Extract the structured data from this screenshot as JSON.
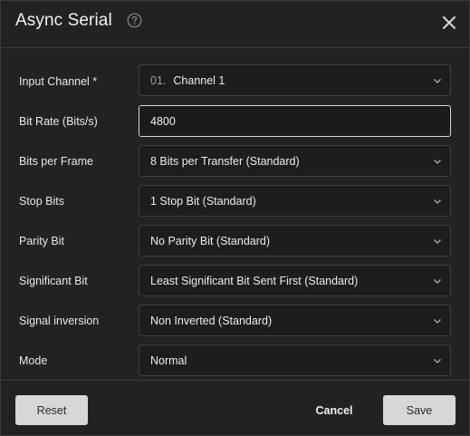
{
  "dialog": {
    "title": "Async Serial",
    "help_icon": "help-circle-icon",
    "close_icon": "close-icon"
  },
  "form": {
    "input_channel": {
      "label": "Input Channel *",
      "prefix": "01.",
      "value": "Channel 1"
    },
    "bit_rate": {
      "label": "Bit Rate (Bits/s)",
      "value": "4800"
    },
    "bits_per_frame": {
      "label": "Bits per Frame",
      "value": "8 Bits per Transfer (Standard)"
    },
    "stop_bits": {
      "label": "Stop Bits",
      "value": "1 Stop Bit (Standard)"
    },
    "parity_bit": {
      "label": "Parity Bit",
      "value": "No Parity Bit (Standard)"
    },
    "significant_bit": {
      "label": "Significant Bit",
      "value": "Least Significant Bit Sent First (Standard)"
    },
    "signal_inversion": {
      "label": "Signal inversion",
      "value": "Non Inverted (Standard)"
    },
    "mode": {
      "label": "Mode",
      "value": "Normal"
    }
  },
  "footer": {
    "reset_label": "Reset",
    "cancel_label": "Cancel",
    "save_label": "Save"
  },
  "colors": {
    "background": "#212223",
    "field_border": "#3f4042",
    "button_light": "#d7d7d7"
  }
}
